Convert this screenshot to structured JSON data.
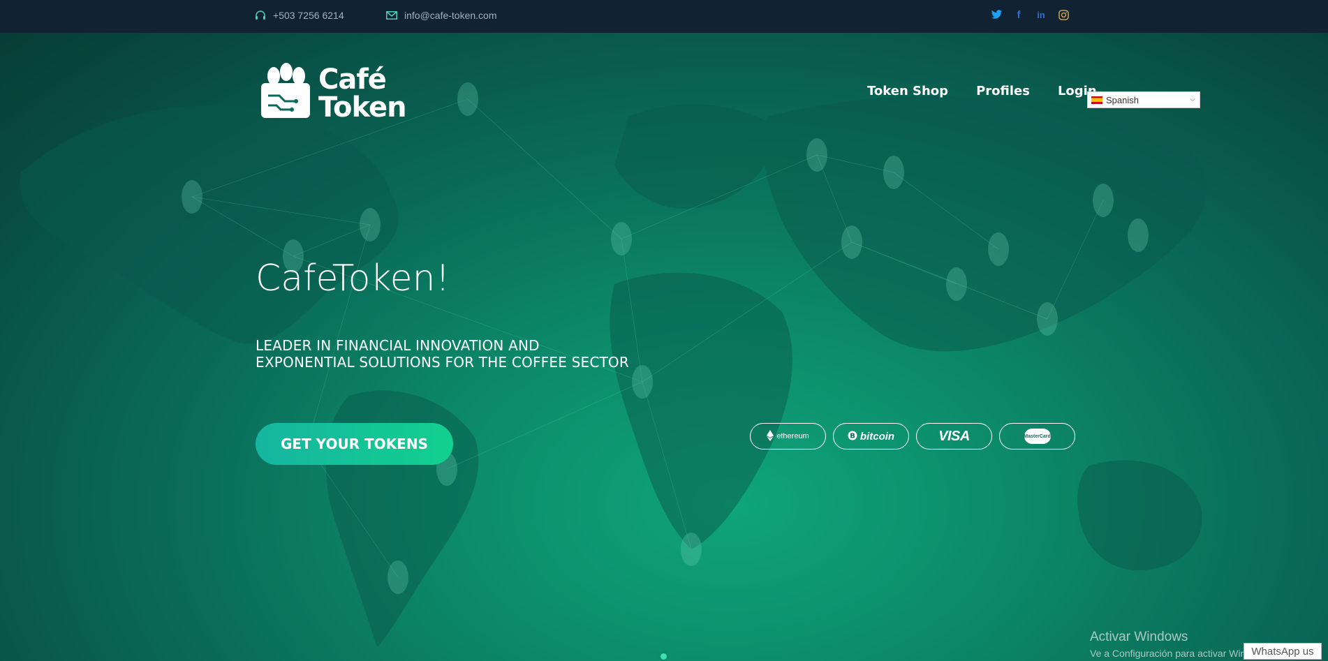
{
  "topbar": {
    "phone": "+503 7256 6214",
    "email": "info@cafe-token.com",
    "social": [
      "twitter-icon",
      "facebook-icon",
      "linkedin-icon",
      "instagram-icon"
    ]
  },
  "header": {
    "logo_line1": "Café",
    "logo_line2": "Token",
    "nav": [
      "Token Shop",
      "Profiles",
      "Login"
    ],
    "language": "Spanish"
  },
  "hero": {
    "title": "CafeToken!",
    "subtitle_line1": "LEADER IN FINANCIAL INNOVATION AND",
    "subtitle_line2": "EXPONENTIAL SOLUTIONS FOR THE COFFEE SECTOR",
    "cta": "GET YOUR TOKENS",
    "payments": {
      "ethereum": "ethereum",
      "bitcoin": "bitcoin",
      "visa": "VISA",
      "mastercard": "MasterCard"
    }
  },
  "watermark": {
    "line1": "Activar Windows",
    "line2": "Ve a Configuración para activar Windows."
  },
  "whatsapp": "WhatsApp us",
  "colors": {
    "topbar": "#112233",
    "accent": "#12d08e",
    "hero": "#0a6a58"
  }
}
